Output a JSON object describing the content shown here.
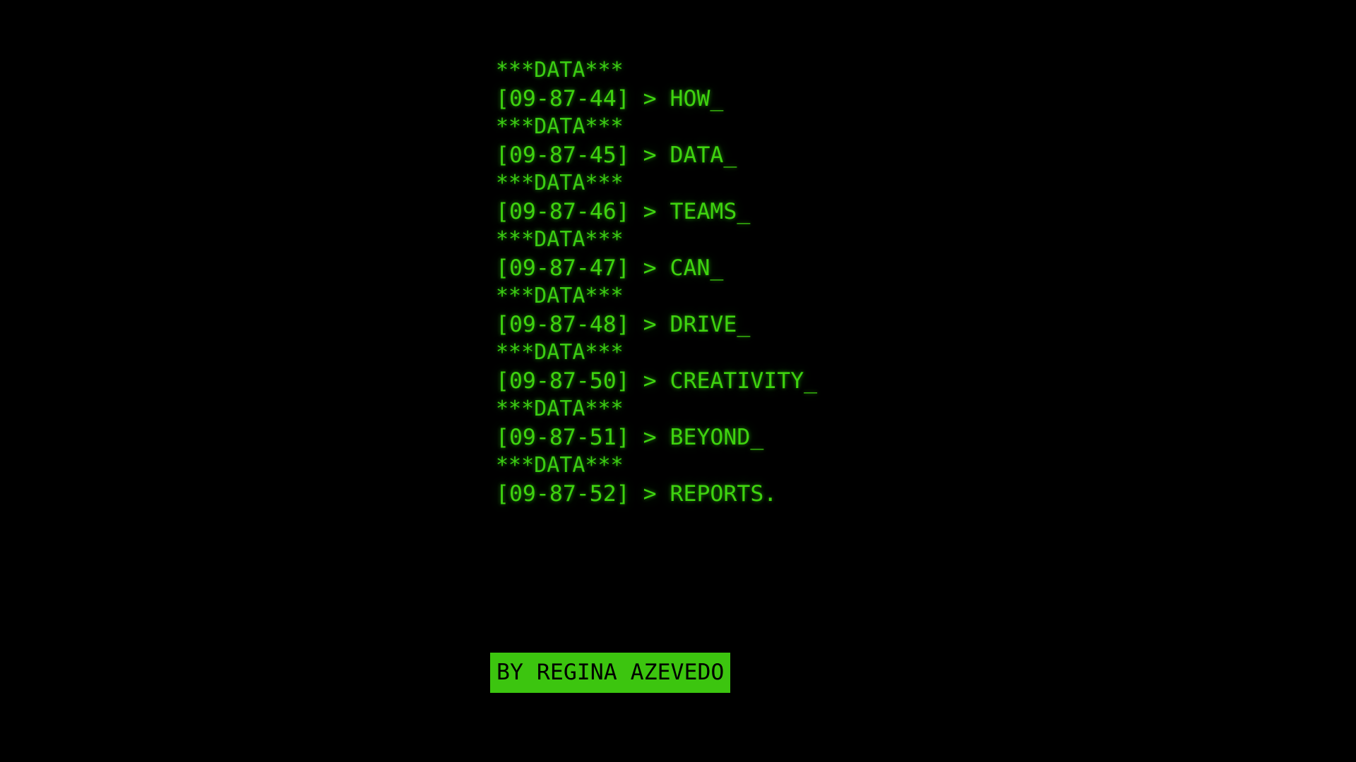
{
  "screen": {
    "background_color": "#000000",
    "text_color": "#3fd30f",
    "separator_color": "#3bcc12",
    "highlight_background_color": "#3cc50f",
    "highlight_text_color": "#000000"
  },
  "terminal": {
    "separator_label": "***DATA***",
    "prompt_symbol": ">",
    "cursor_glyph": "_",
    "entries": [
      {
        "separator": "***DATA***",
        "id": "[09-87-44]",
        "prompt": ">",
        "word": "HOW_",
        "line": "[09-87-44] > HOW_"
      },
      {
        "separator": "***DATA***",
        "id": "[09-87-45]",
        "prompt": ">",
        "word": "DATA_",
        "line": "[09-87-45] > DATA_"
      },
      {
        "separator": "***DATA***",
        "id": "[09-87-46]",
        "prompt": ">",
        "word": "TEAMS_",
        "line": "[09-87-46] > TEAMS_"
      },
      {
        "separator": "***DATA***",
        "id": "[09-87-47]",
        "prompt": ">",
        "word": "CAN_",
        "line": "[09-87-47] > CAN_"
      },
      {
        "separator": "***DATA***",
        "id": "[09-87-48]",
        "prompt": ">",
        "word": "DRIVE_",
        "line": "[09-87-48] > DRIVE_"
      },
      {
        "separator": "***DATA***",
        "id": "[09-87-50]",
        "prompt": ">",
        "word": "CREATIVITY_",
        "line": "[09-87-50] > CREATIVITY_"
      },
      {
        "separator": "***DATA***",
        "id": "[09-87-51]",
        "prompt": ">",
        "word": "BEYOND_",
        "line": "[09-87-51] > BEYOND_"
      },
      {
        "separator": "***DATA***",
        "id": "[09-87-52]",
        "prompt": ">",
        "word": "REPORTS.",
        "line": "[09-87-52] > REPORTS."
      }
    ],
    "message_text": "HOW DATA TEAMS CAN DRIVE CREATIVITY BEYOND REPORTS."
  },
  "credit": {
    "label": "BY REGINA AZEVEDO"
  }
}
